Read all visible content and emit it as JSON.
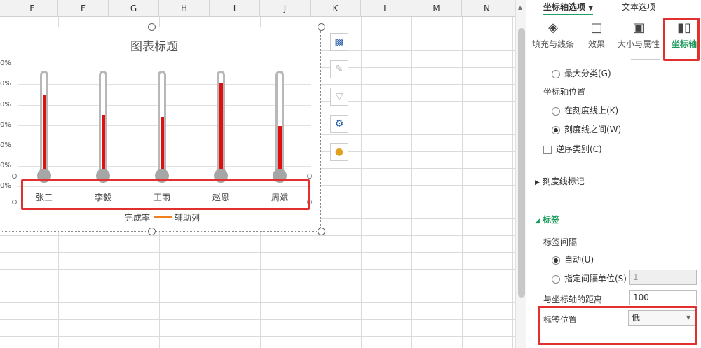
{
  "spreadsheet": {
    "columns": [
      "E",
      "F",
      "G",
      "H",
      "I",
      "J",
      "K",
      "L",
      "M",
      "N"
    ]
  },
  "chart": {
    "title": "图表标题",
    "y_ticks": [
      "0%",
      "0%",
      "0%",
      "0%",
      "0%",
      "0%",
      "0%"
    ],
    "legend": {
      "series1": "完成率",
      "series2": "辅助列"
    }
  },
  "chart_data": {
    "type": "bar",
    "title": "图表标题",
    "categories": [
      "张三",
      "李毅",
      "王雨",
      "赵恩",
      "周斌"
    ],
    "series": [
      {
        "name": "完成率",
        "values": [
          0.82,
          0.62,
          0.6,
          0.95,
          0.5
        ]
      },
      {
        "name": "辅助列",
        "values": [
          1,
          1,
          1,
          1,
          1
        ]
      }
    ],
    "ylim": [
      0,
      1
    ],
    "grid": true,
    "legend_position": "bottom"
  },
  "side_tools": {
    "chart_elements": "chart-elements-icon",
    "chart_styles": "brush-icon",
    "chart_filter": "filter-icon",
    "settings": "gear-icon",
    "idea": "lightbulb-icon"
  },
  "panel": {
    "tabs": {
      "axis_options": "坐标轴选项",
      "text_options": "文本选项"
    },
    "icon_tabs": {
      "fill_line": "填充与线条",
      "effects": "效果",
      "size_props": "大小与属性",
      "axis": "坐标轴"
    },
    "max_category": "最大分类(G)",
    "axis_position_label": "坐标轴位置",
    "on_tick_marks": "在刻度线上(K)",
    "between_tick_marks": "刻度线之间(W)",
    "reverse_categories": "逆序类别(C)",
    "tick_marks_section": "刻度线标记",
    "labels_section": "标签",
    "label_interval_label": "标签间隔",
    "auto": "自动(U)",
    "specify_interval": "指定间隔单位(S)",
    "interval_value": "1",
    "distance_label": "与坐标轴的距离",
    "distance_value": "100",
    "label_position_label": "标签位置",
    "label_position_value": "低"
  },
  "colors": {
    "accent": "#1a9a5a",
    "thermometer_fill": "#e01010",
    "highlight_box": "#e03030",
    "legend_line": "#f07f1c"
  }
}
